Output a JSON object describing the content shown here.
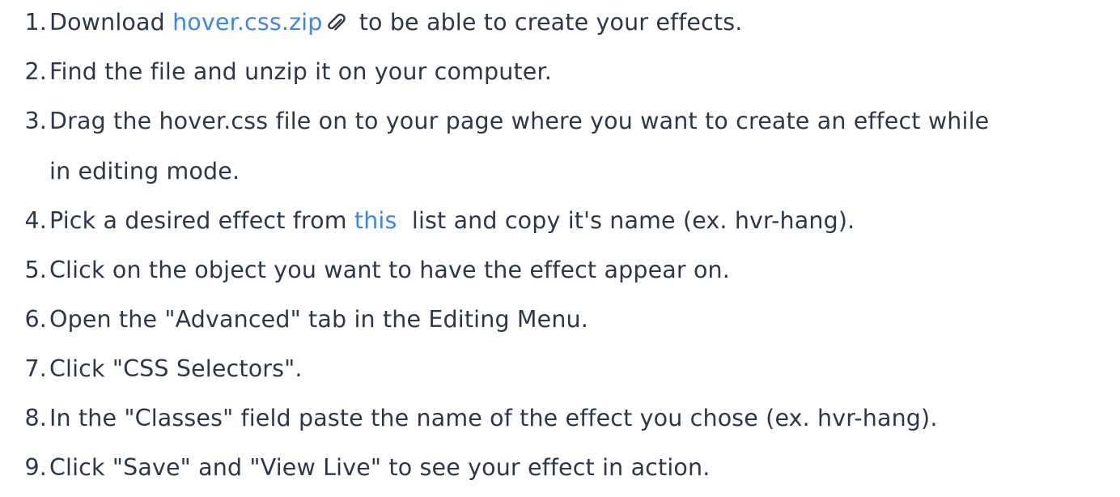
{
  "steps": [
    {
      "number": "1.",
      "before": "Download ",
      "link": "hover.css.zip",
      "icon": "paperclip-icon",
      "after": " to be able to create your effects."
    },
    {
      "number": "2.",
      "text": "Find the file and unzip it on your computer."
    },
    {
      "number": "3.",
      "text": "Drag the hover.css file on to your page where you want to create an effect while",
      "text_line2": "in editing mode."
    },
    {
      "number": "4.",
      "before": "Pick a desired effect from ",
      "link": "this",
      "after": "  list and copy it's name (ex. hvr-hang)."
    },
    {
      "number": "5.",
      "text": "Click on the object you want to have the effect appear on."
    },
    {
      "number": "6.",
      "text": "Open the \"Advanced\" tab in the Editing Menu."
    },
    {
      "number": "7.",
      "text": "Click \"CSS Selectors\"."
    },
    {
      "number": "8.",
      "text": "In the \"Classes\" field paste the name of the effect you chose (ex. hvr-hang)."
    },
    {
      "number": "9.",
      "text": "Click \"Save\" and \"View Live\" to see your effect in action."
    }
  ],
  "colors": {
    "text": "#2d3748",
    "link": "#3c86e8"
  }
}
